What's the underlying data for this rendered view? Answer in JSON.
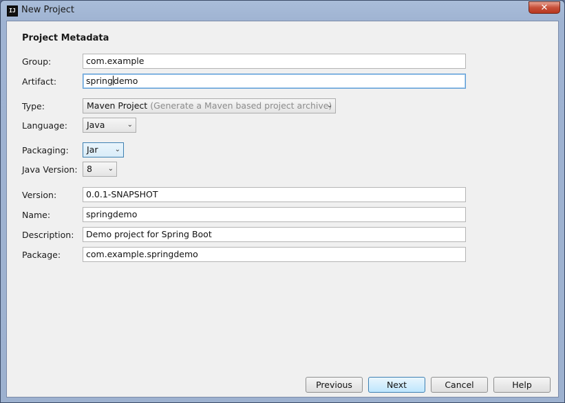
{
  "window": {
    "title": "New Project",
    "app_icon": "IJ",
    "close_glyph": "✕"
  },
  "section_title": "Project Metadata",
  "fields": {
    "group": {
      "label": "Group:",
      "value": "com.example"
    },
    "artifact": {
      "label": "Artifact:",
      "value_before_caret": "spring",
      "value_after_caret": "demo"
    },
    "type": {
      "label": "Type:",
      "value": "Maven Project",
      "hint": "(Generate a Maven based project archive)"
    },
    "language": {
      "label": "Language:",
      "value": "Java"
    },
    "packaging": {
      "label": "Packaging:",
      "value": "Jar"
    },
    "java_version": {
      "label": "Java Version:",
      "value": "8"
    },
    "version": {
      "label": "Version:",
      "value": "0.0.1-SNAPSHOT"
    },
    "name": {
      "label": "Name:",
      "value": "springdemo"
    },
    "description": {
      "label": "Description:",
      "value": "Demo project for Spring Boot"
    },
    "package": {
      "label": "Package:",
      "value": "com.example.springdemo"
    }
  },
  "buttons": {
    "previous": "Previous",
    "next": "Next",
    "cancel": "Cancel",
    "help": "Help"
  },
  "icons": {
    "dropdown": "chevron-down-icon"
  },
  "colors": {
    "focus": "#5b9bd5",
    "default_button": "#bee6fd",
    "titlebar": "#a9bdd9"
  }
}
